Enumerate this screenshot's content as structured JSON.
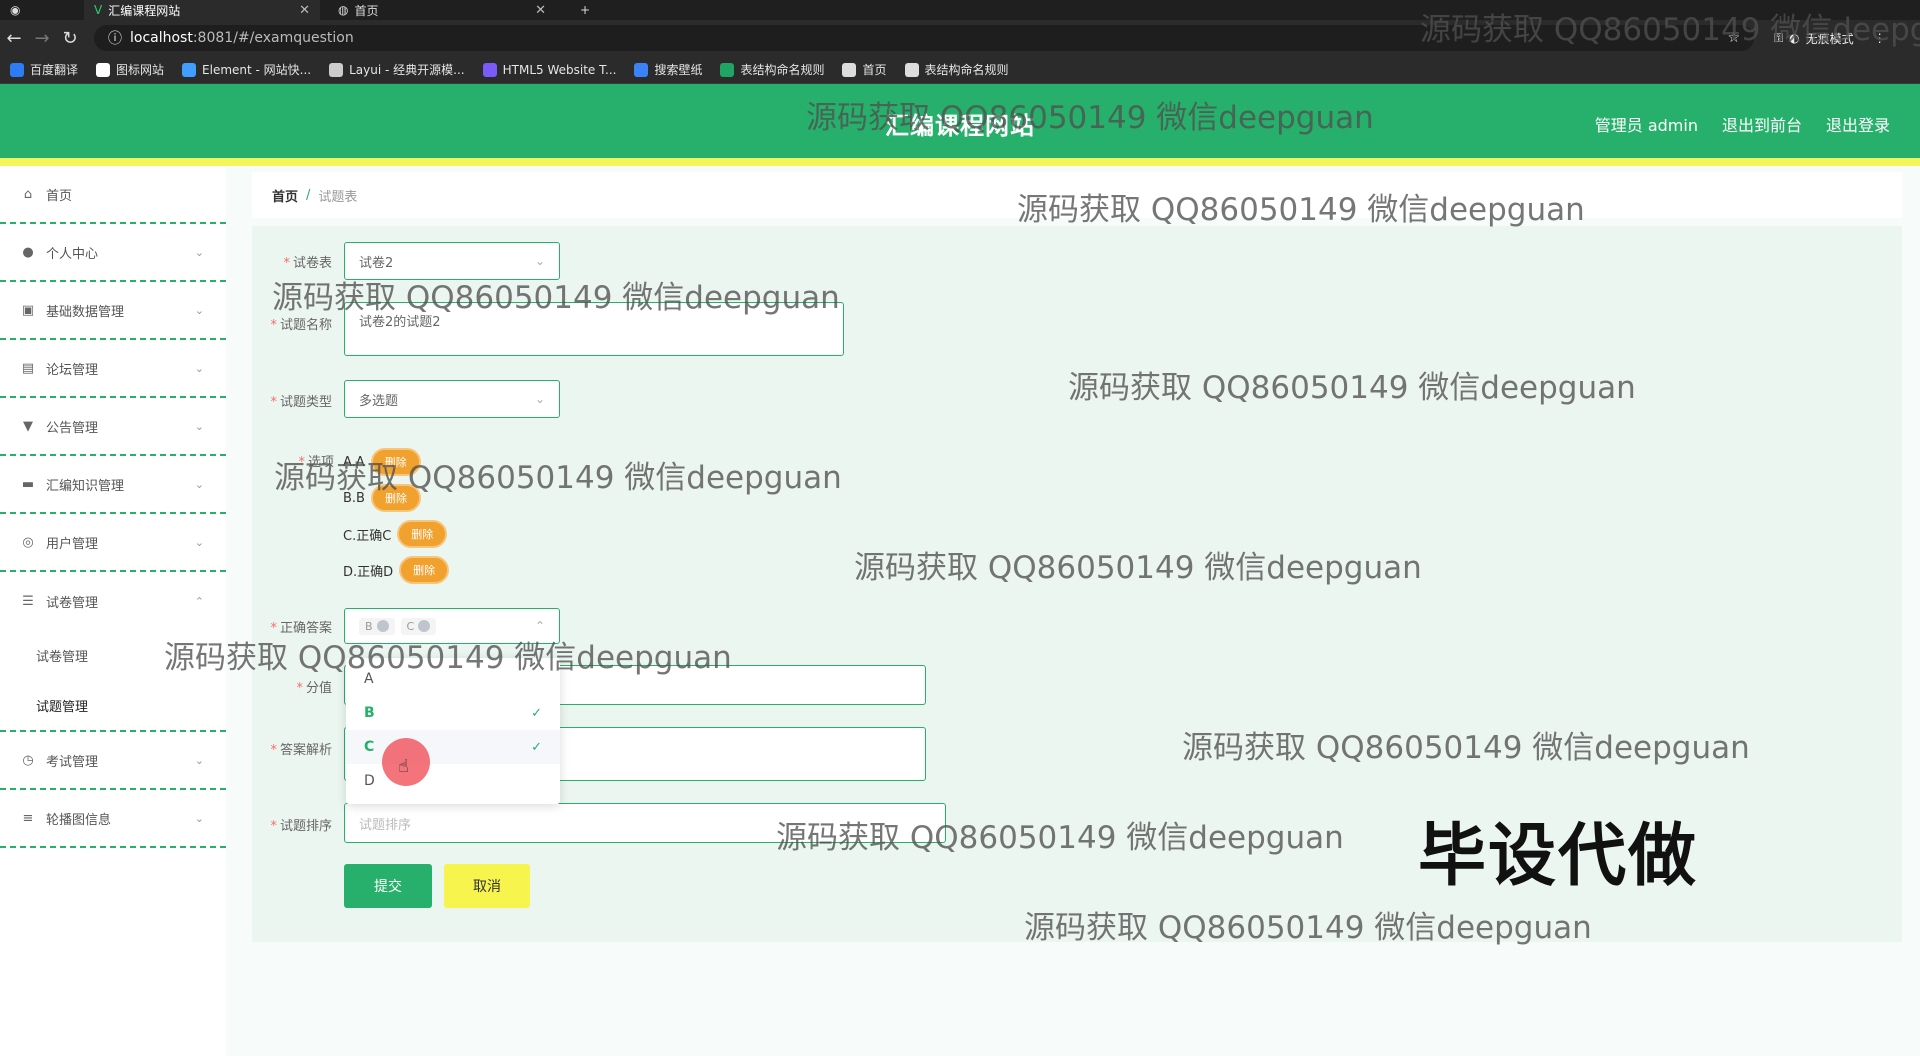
{
  "browser": {
    "tabs": [
      {
        "title": "汇编课程网站",
        "active": true
      },
      {
        "title": "首页",
        "active": false
      }
    ],
    "new_tab": "+",
    "url_host": "localhost",
    "url_path": ":8081/#/examquestion",
    "incognito_label": "无痕模式",
    "bookmarks": [
      {
        "label": "百度翻译",
        "color": "#2d7cf6"
      },
      {
        "label": "图标网站",
        "color": "#ffffff"
      },
      {
        "label": "Element - 网站快...",
        "color": "#409eff"
      },
      {
        "label": "Layui - 经典开源模...",
        "color": "#cccccc"
      },
      {
        "label": "HTML5 Website T...",
        "color": "#7a5af8"
      },
      {
        "label": "搜索壁纸",
        "color": "#3b82f6"
      },
      {
        "label": "表结构命名规则",
        "color": "#1fa463"
      },
      {
        "label": "首页",
        "color": "#dddddd"
      },
      {
        "label": "表结构命名规则",
        "color": "#dddddd"
      }
    ]
  },
  "header": {
    "title": "汇编课程网站",
    "links": [
      "管理员 admin",
      "退出到前台",
      "退出登录"
    ]
  },
  "sidebar": {
    "items": [
      {
        "label": "首页",
        "icon": "home-icon",
        "glyph": "⌂"
      },
      {
        "label": "个人中心",
        "icon": "user-icon",
        "glyph": "●"
      },
      {
        "label": "基础数据管理",
        "icon": "database-icon",
        "glyph": "▣"
      },
      {
        "label": "论坛管理",
        "icon": "forum-icon",
        "glyph": "▤"
      },
      {
        "label": "公告管理",
        "icon": "notice-icon",
        "glyph": "▼"
      },
      {
        "label": "汇编知识管理",
        "icon": "knowledge-icon",
        "glyph": "▬"
      },
      {
        "label": "用户管理",
        "icon": "users-icon",
        "glyph": "◎"
      },
      {
        "label": "试卷管理",
        "icon": "list-icon",
        "glyph": "☰"
      }
    ],
    "sub_items": [
      "试卷管理",
      "试题管理"
    ],
    "items_after": [
      {
        "label": "考试管理",
        "icon": "clock-icon",
        "glyph": "◷"
      },
      {
        "label": "轮播图信息",
        "icon": "sliders-icon",
        "glyph": "≡"
      }
    ]
  },
  "breadcrumb": {
    "home": "首页",
    "sep": "/",
    "current": "试题表"
  },
  "form": {
    "paper_label": "试卷表",
    "paper_value": "试卷2",
    "name_label": "试题名称",
    "name_value": "试卷2的试题2",
    "type_label": "试题类型",
    "type_value": "多选题",
    "options_label": "选项",
    "options": [
      "A.A",
      "B.B",
      "C.正确C",
      "D.正确D"
    ],
    "delete_label": "删除",
    "answer_label": "正确答案",
    "answer_tags": [
      "B",
      "C"
    ],
    "score_label": "分值",
    "analysis_label": "答案解析",
    "sort_label": "试题排序",
    "sort_placeholder": "试题排序",
    "submit": "提交",
    "cancel": "取消"
  },
  "dropdown": {
    "options": [
      "A",
      "B",
      "C",
      "D"
    ],
    "selected": [
      "B",
      "C"
    ]
  },
  "watermark": {
    "text": "源码获取 QQ86050149 微信deepguan",
    "big": "毕设代做"
  }
}
